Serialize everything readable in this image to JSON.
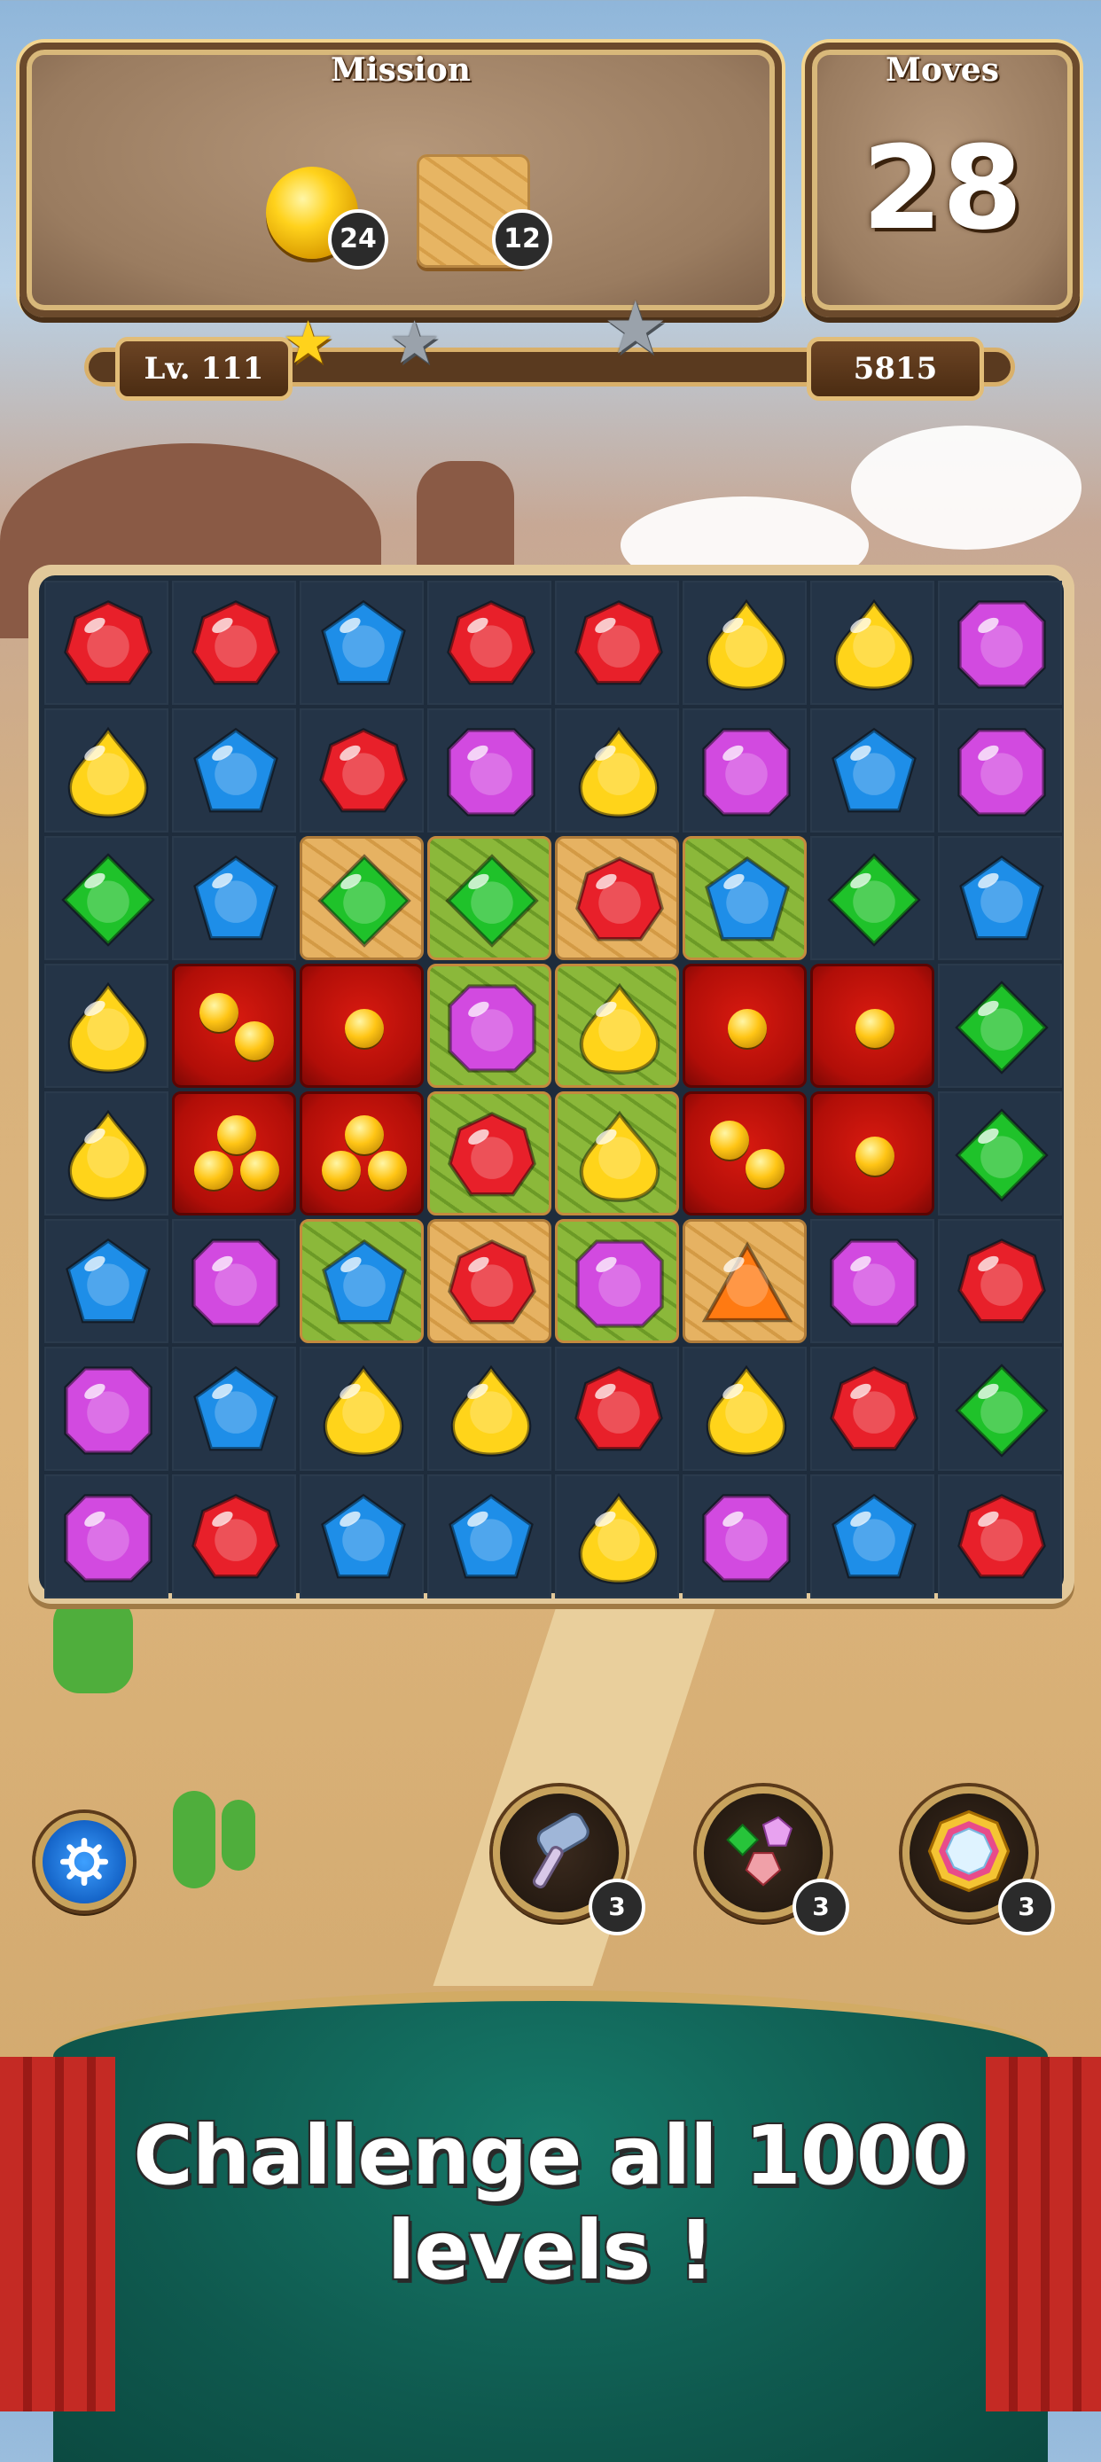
{
  "hud": {
    "mission": {
      "title": "Mission",
      "goals": [
        {
          "icon": "gold-coin-icon",
          "count": "24"
        },
        {
          "icon": "cracked-tile-icon",
          "count": "12"
        }
      ]
    },
    "moves": {
      "title": "Moves",
      "value": "28"
    },
    "level": {
      "label": "Lv. 111",
      "score": "5815",
      "stars_earned": 1,
      "stars_total": 3,
      "progress": 0.02
    }
  },
  "gem_colors": {
    "red": "#e8202a",
    "yellow": "#ffd41a",
    "blue": "#1e8ee8",
    "purple": "#d24ae0",
    "green": "#1fc22a",
    "orange": "#ff7a12"
  },
  "board": {
    "rows": 8,
    "cols": 8,
    "cells": [
      [
        {
          "gem": "red"
        },
        {
          "gem": "red"
        },
        {
          "gem": "blue"
        },
        {
          "gem": "red"
        },
        {
          "gem": "red"
        },
        {
          "gem": "yellow"
        },
        {
          "gem": "yellow"
        },
        {
          "gem": "purple"
        }
      ],
      [
        {
          "gem": "yellow"
        },
        {
          "gem": "blue"
        },
        {
          "gem": "red"
        },
        {
          "gem": "purple"
        },
        {
          "gem": "yellow"
        },
        {
          "gem": "purple"
        },
        {
          "gem": "blue"
        },
        {
          "gem": "purple"
        }
      ],
      [
        {
          "gem": "green"
        },
        {
          "gem": "blue"
        },
        {
          "gem": "green",
          "tile": "cracked"
        },
        {
          "gem": "green",
          "tile": "grass"
        },
        {
          "gem": "red",
          "tile": "cracked"
        },
        {
          "gem": "blue",
          "tile": "grass"
        },
        {
          "gem": "green"
        },
        {
          "gem": "blue"
        }
      ],
      [
        {
          "gem": "yellow"
        },
        {
          "tile": "brick",
          "balls": 2
        },
        {
          "tile": "brick",
          "balls": 1
        },
        {
          "gem": "purple",
          "tile": "grass"
        },
        {
          "gem": "yellow",
          "tile": "grass"
        },
        {
          "tile": "brick",
          "balls": 1
        },
        {
          "tile": "brick",
          "balls": 1
        },
        {
          "gem": "green"
        }
      ],
      [
        {
          "gem": "yellow"
        },
        {
          "tile": "brick",
          "balls": 3
        },
        {
          "tile": "brick",
          "balls": 3
        },
        {
          "gem": "red",
          "tile": "grass"
        },
        {
          "gem": "yellow",
          "tile": "grass"
        },
        {
          "tile": "brick",
          "balls": 2
        },
        {
          "tile": "brick",
          "balls": 1
        },
        {
          "gem": "green"
        }
      ],
      [
        {
          "gem": "blue"
        },
        {
          "gem": "purple"
        },
        {
          "gem": "blue",
          "tile": "grass"
        },
        {
          "gem": "red",
          "tile": "cracked"
        },
        {
          "gem": "purple",
          "tile": "grass"
        },
        {
          "gem": "orange",
          "tile": "cracked"
        },
        {
          "gem": "purple"
        },
        {
          "gem": "red"
        }
      ],
      [
        {
          "gem": "purple"
        },
        {
          "gem": "blue"
        },
        {
          "gem": "yellow"
        },
        {
          "gem": "yellow"
        },
        {
          "gem": "red"
        },
        {
          "gem": "yellow"
        },
        {
          "gem": "red"
        },
        {
          "gem": "green"
        }
      ],
      [
        {
          "gem": "purple"
        },
        {
          "gem": "red"
        },
        {
          "gem": "blue"
        },
        {
          "gem": "blue"
        },
        {
          "gem": "yellow"
        },
        {
          "gem": "purple"
        },
        {
          "gem": "blue"
        },
        {
          "gem": "red"
        }
      ]
    ]
  },
  "controls": {
    "settings": {
      "icon": "gear-icon"
    },
    "boosters": [
      {
        "icon": "hammer-icon",
        "count": "3"
      },
      {
        "icon": "color-swap-icon",
        "count": "3"
      },
      {
        "icon": "rainbow-gem-icon",
        "count": "3"
      }
    ]
  },
  "banner": {
    "text": "Challenge all 1000 levels !"
  }
}
